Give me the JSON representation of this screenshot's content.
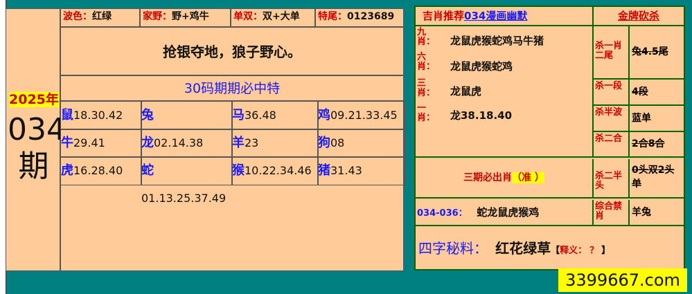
{
  "year_label": "2025年",
  "issue_number": "034",
  "issue_suffix": "期",
  "top_bar": {
    "wave": {
      "label": "波色：",
      "value": "红绿"
    },
    "home_wild": {
      "label": "家野：",
      "value": "野+鸡牛"
    },
    "odd_even": {
      "label": "单双：",
      "value": "双+大单"
    },
    "tail": {
      "label": "特尾：",
      "value": "0123689"
    }
  },
  "slogan": "抢银夺地，狼子野心。",
  "code_title": "30码期期必中特",
  "zodiac_grid": [
    [
      {
        "z": "鼠",
        "n": "18.30.42"
      },
      {
        "z": "兔",
        "n": ""
      },
      {
        "z": "马",
        "n": "36.48"
      },
      {
        "z": "鸡",
        "n": "09.21.33.45"
      }
    ],
    [
      {
        "z": "牛",
        "n": "29.41"
      },
      {
        "z": "龙",
        "n": "02.14.38"
      },
      {
        "z": "羊",
        "n": "23"
      },
      {
        "z": "狗",
        "n": "08"
      }
    ],
    [
      {
        "z": "虎",
        "n": "16.28.40"
      },
      {
        "z": "蛇",
        "n": "01.13.25.37.49"
      },
      {
        "z": "猴",
        "n": "10.22.34.46"
      },
      {
        "z": "猪",
        "n": "31.43"
      }
    ]
  ],
  "right": {
    "rec_prefix": "吉肖推荐",
    "rec_link": "034漫画幽默",
    "kill_title": "金牌砍杀",
    "picks": [
      {
        "label": "九\n肖：",
        "value": "龙鼠虎猴蛇鸡马牛猪"
      },
      {
        "label": "六\n肖：",
        "value": "龙鼠虎猴蛇鸡"
      },
      {
        "label": "三\n肖：",
        "value": "龙鼠虎"
      },
      {
        "label": "一\n肖：",
        "value": "龙38.18.40"
      }
    ],
    "kills": [
      {
        "label": "杀一肖二尾",
        "value": "兔4.5尾"
      },
      {
        "label": "杀一段",
        "value": "4段"
      },
      {
        "label": "杀半波",
        "value": "蓝单"
      },
      {
        "label": "杀二合",
        "value": "2合8合"
      },
      {
        "label": "杀二半头",
        "value": "0头双2头单"
      },
      {
        "label": "综合禁肖",
        "value": "羊兔"
      }
    ],
    "must_text": "三期必出肖",
    "must_badge": "（准 ）",
    "range_label": "034-036：",
    "range_value": "蛇龙鼠虎猴鸡",
    "secret_label": "四字秘料：",
    "secret_value": "红花绿草",
    "secret_note_open": "【",
    "secret_note_label": "释义：",
    "secret_note_q": "？",
    "secret_note_close": "】"
  },
  "watermark": "3399667.com"
}
